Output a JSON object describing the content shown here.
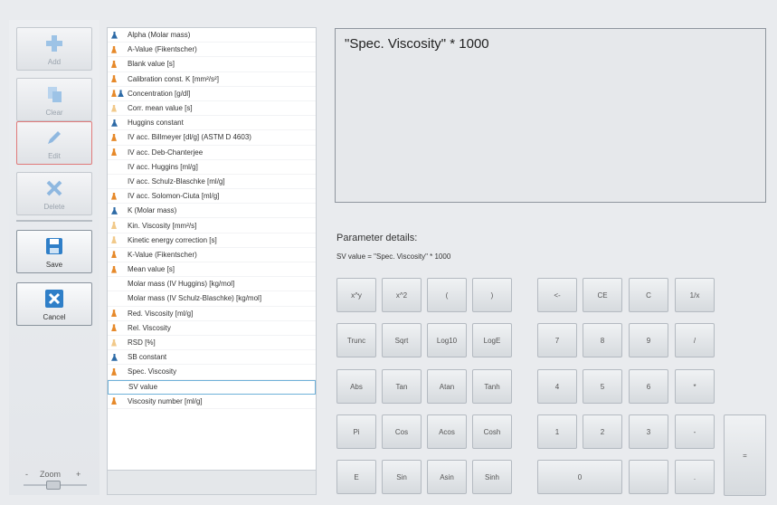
{
  "toolbar": {
    "add": "Add",
    "clear": "Clear",
    "edit": "Edit",
    "delete": "Delete",
    "save": "Save",
    "cancel": "Cancel",
    "zoom_label": "Zoom",
    "zoom_minus": "-",
    "zoom_plus": "+"
  },
  "parameters": [
    {
      "icon": "person",
      "label": "Alpha (Molar mass)"
    },
    {
      "icon": "flask",
      "label": "A-Value (Fikentscher)"
    },
    {
      "icon": "flask",
      "label": "Blank value [s]"
    },
    {
      "icon": "flask",
      "label": "Calibration const. K [mm²/s²]"
    },
    {
      "icon": "flask-person",
      "label": "Concentration [g/dl]"
    },
    {
      "icon": "flask-light",
      "label": "Corr. mean value [s]"
    },
    {
      "icon": "person",
      "label": "Huggins constant"
    },
    {
      "icon": "flask",
      "label": "IV acc. Billmeyer [dl/g] (ASTM D 4603)"
    },
    {
      "icon": "flask",
      "label": "IV acc. Deb-Chanterjee"
    },
    {
      "icon": "none",
      "label": "IV acc. Huggins [ml/g]"
    },
    {
      "icon": "none",
      "label": "IV acc. Schulz-Blaschke [ml/g]"
    },
    {
      "icon": "flask",
      "label": "IV acc. Solomon-Ciuta [ml/g]"
    },
    {
      "icon": "person",
      "label": "K (Molar mass)"
    },
    {
      "icon": "flask-light",
      "label": "Kin. Viscosity [mm²/s]"
    },
    {
      "icon": "flask-light",
      "label": "Kinetic energy correction [s]"
    },
    {
      "icon": "flask",
      "label": "K-Value (Fikentscher)"
    },
    {
      "icon": "flask",
      "label": "Mean value [s]"
    },
    {
      "icon": "none",
      "label": "Molar mass (IV Huggins) [kg/mol]"
    },
    {
      "icon": "none",
      "label": "Molar mass (IV Schulz-Blaschke) [kg/mol]"
    },
    {
      "icon": "flask",
      "label": "Red. Viscosity [ml/g]"
    },
    {
      "icon": "flask",
      "label": "Rel. Viscosity"
    },
    {
      "icon": "flask-light",
      "label": "RSD [%]"
    },
    {
      "icon": "person",
      "label": "SB constant"
    },
    {
      "icon": "flask",
      "label": "Spec. Viscosity"
    },
    {
      "icon": "none",
      "label": "SV value",
      "selected": true
    },
    {
      "icon": "flask",
      "label": "Viscosity number [ml/g]"
    }
  ],
  "formula": "\"Spec. Viscosity\" * 1000",
  "parameter_details": {
    "title": "Parameter details:",
    "text": "SV value = \"Spec. Viscosity\" * 1000"
  },
  "keypad": {
    "func": [
      [
        "x^y",
        "x^2",
        "(",
        ")"
      ],
      [
        "Trunc",
        "Sqrt",
        "Log10",
        "LogE"
      ],
      [
        "Abs",
        "Tan",
        "Atan",
        "Tanh"
      ],
      [
        "Pi",
        "Cos",
        "Acos",
        "Cosh"
      ],
      [
        "E",
        "Sin",
        "Asin",
        "Sinh"
      ]
    ],
    "num": [
      [
        "<-",
        "CE",
        "C",
        "1/x"
      ],
      [
        "7",
        "8",
        "9",
        "/"
      ],
      [
        "4",
        "5",
        "6",
        "*"
      ],
      [
        "1",
        "2",
        "3",
        "-"
      ],
      [
        "0",
        "",
        "."
      ]
    ],
    "plus": "+",
    "equals": "="
  },
  "colors": {
    "flask": "#e6892a",
    "person": "#2d6aa6",
    "selection": "#6fb1d9",
    "edit_border": "#e07a7a"
  }
}
